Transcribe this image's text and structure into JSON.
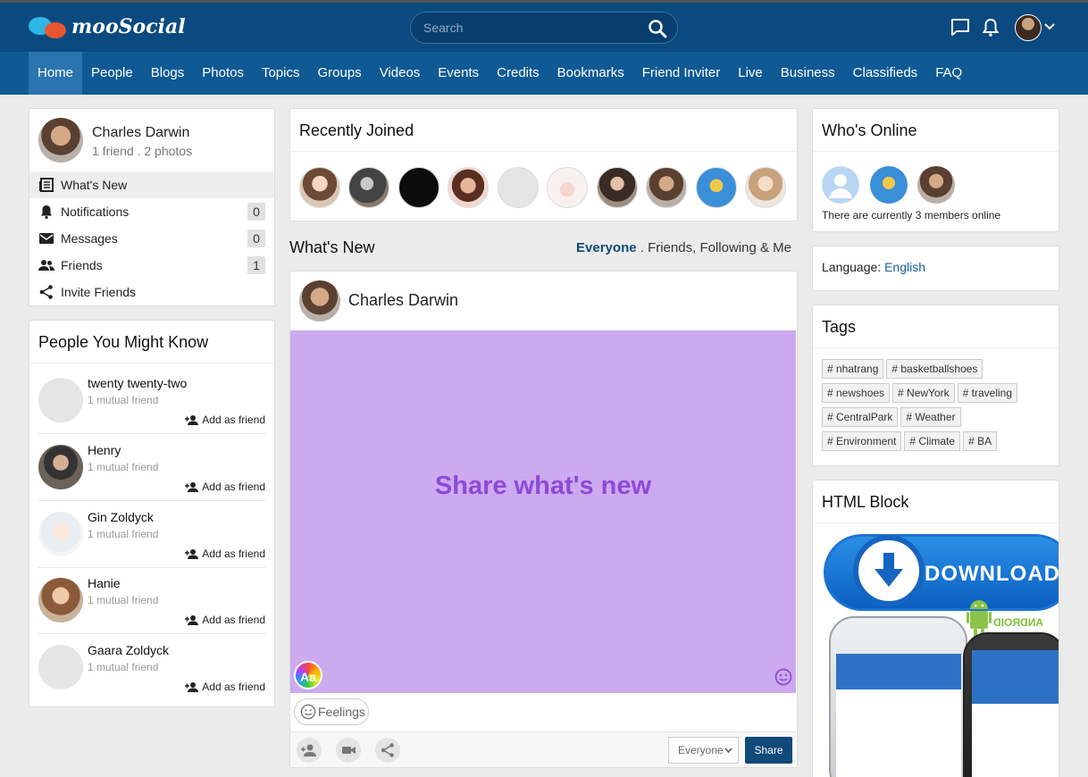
{
  "header": {
    "brand": "mooSocial",
    "search_placeholder": "Search"
  },
  "nav": {
    "items": [
      "Home",
      "People",
      "Blogs",
      "Photos",
      "Topics",
      "Groups",
      "Videos",
      "Events",
      "Credits",
      "Bookmarks",
      "Friend Inviter",
      "Live",
      "Business",
      "Classifieds",
      "FAQ"
    ],
    "active": "Home"
  },
  "profile": {
    "name": "Charles Darwin",
    "stats": "1 friend . 2 photos",
    "menu": [
      {
        "label": "What's New",
        "icon": "newspaper-icon"
      },
      {
        "label": "Notifications",
        "icon": "bell-icon",
        "count": "0"
      },
      {
        "label": "Messages",
        "icon": "envelope-icon",
        "count": "0"
      },
      {
        "label": "Friends",
        "icon": "people-icon",
        "count": "1"
      },
      {
        "label": "Invite Friends",
        "icon": "share-icon"
      }
    ]
  },
  "pymk": {
    "title": "People You Might Know",
    "add_label": "Add as friend",
    "people": [
      {
        "name": "twenty twenty-two",
        "mutual": "1 mutual friend"
      },
      {
        "name": "Henry",
        "mutual": "1 mutual friend"
      },
      {
        "name": "Gin Zoldyck",
        "mutual": "1 mutual friend"
      },
      {
        "name": "Hanie",
        "mutual": "1 mutual friend"
      },
      {
        "name": "Gaara Zoldyck",
        "mutual": "1 mutual friend"
      }
    ]
  },
  "recently_joined": {
    "title": "Recently Joined",
    "avatar_count": 10
  },
  "whats_new": {
    "title": "What's New",
    "filter_active": "Everyone",
    "filter_sep": ".",
    "filter_other": "Friends, Following & Me"
  },
  "composer": {
    "name": "Charles Darwin",
    "prompt": "Share what's new",
    "aa_label": "Aa",
    "feelings_label": "Feelings",
    "privacy": "Everyone",
    "share_label": "Share",
    "bg_color": "#cda9ef",
    "text_color": "#8c4ad6"
  },
  "whos_online": {
    "title": "Who's Online",
    "status": "There are currently 3 members online"
  },
  "language": {
    "label": "Language:",
    "value": "English"
  },
  "tags": {
    "title": "Tags",
    "items": [
      "# nhatrang",
      "# basketballshoes",
      "# newshoes",
      "# NewYork",
      "# traveling",
      "# CentralPark",
      "# Weather",
      "# Environment",
      "# Climate",
      "# BA"
    ]
  },
  "html_block": {
    "title": "HTML Block",
    "download_label": "DOWNLOAD",
    "android_label": "ANDROID"
  },
  "colors": {
    "header": "#0a4a80",
    "nav": "#0f5a94",
    "nav_active": "#2a74b0",
    "share_button": "#0f4a7a"
  }
}
